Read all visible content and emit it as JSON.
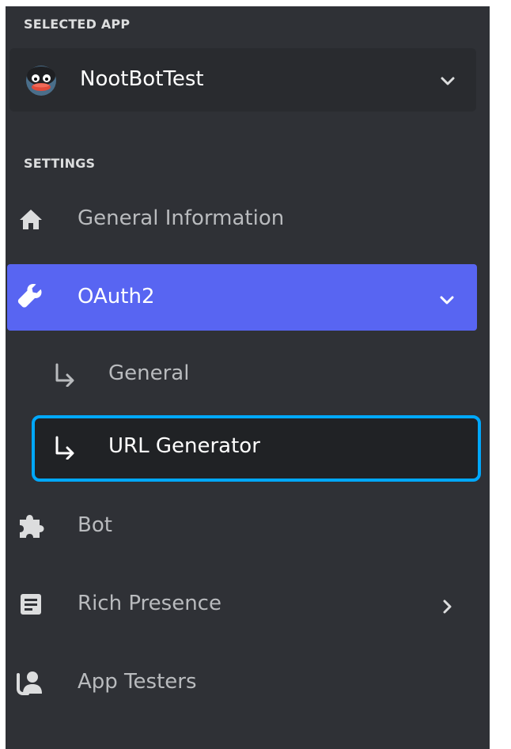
{
  "selected_app": {
    "section_label": "SELECTED APP",
    "name": "NootBotTest",
    "avatar_icon": "penguin-avatar-icon",
    "dropdown_icon": "chevron-down-icon"
  },
  "settings": {
    "section_label": "SETTINGS",
    "items": [
      {
        "label": "General Information",
        "icon": "home-icon"
      },
      {
        "label": "OAuth2",
        "icon": "wrench-icon",
        "active": true,
        "expanded": true
      },
      {
        "label": "General",
        "icon": "subitem-arrow-icon",
        "sub": true
      },
      {
        "label": "URL Generator",
        "icon": "subitem-arrow-icon",
        "sub": true,
        "selected": true
      },
      {
        "label": "Bot",
        "icon": "puzzle-icon"
      },
      {
        "label": "Rich Presence",
        "icon": "document-icon",
        "chevron": "chevron-right-icon"
      },
      {
        "label": "App Testers",
        "icon": "testers-icon"
      }
    ]
  },
  "colors": {
    "sidebar_bg": "#2f3136",
    "select_bg": "#292b2f",
    "active_bg": "#5865f2",
    "selected_border": "#00a8fc",
    "text_muted": "#b9bbbe",
    "text_white": "#ffffff"
  }
}
